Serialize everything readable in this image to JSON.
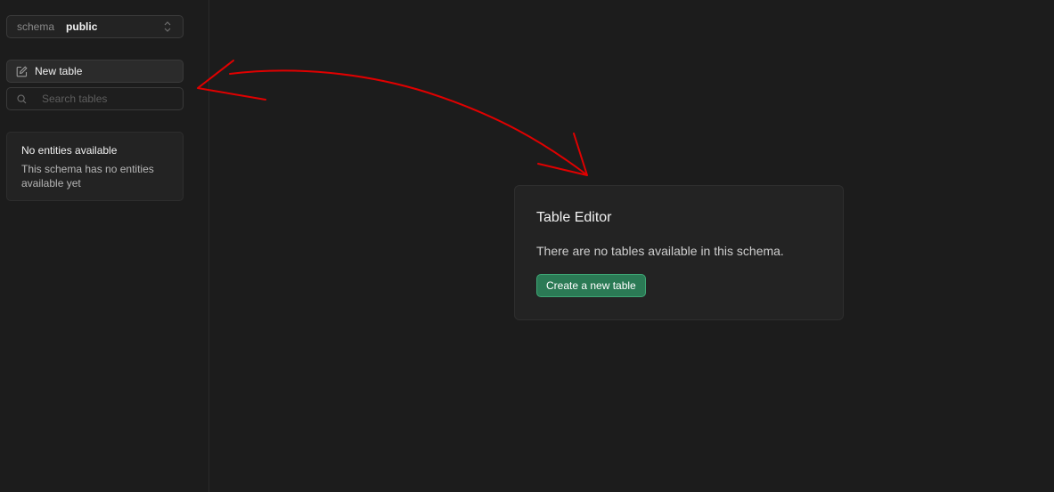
{
  "sidebar": {
    "schema": {
      "label": "schema",
      "value": "public"
    },
    "new_table_label": "New table",
    "search": {
      "placeholder": "Search tables",
      "value": ""
    },
    "empty_state": {
      "title": "No entities available",
      "description": "This schema has no entities available yet"
    }
  },
  "main": {
    "card": {
      "title": "Table Editor",
      "message": "There are no tables available in this schema.",
      "button_label": "Create a new table"
    }
  },
  "colors": {
    "background": "#1c1c1c",
    "panel": "#232323",
    "accent": "#2b7a55",
    "annotation": "#e00000"
  },
  "icons": [
    "chevron-up-down-icon",
    "edit-icon",
    "search-icon"
  ]
}
